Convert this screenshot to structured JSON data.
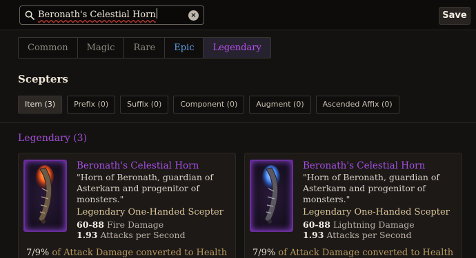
{
  "search": {
    "value": "Beronath's Celestial Horn",
    "clear_icon": "×"
  },
  "toolbar": {
    "save_label": "Save"
  },
  "rarity_tabs": [
    {
      "label": "Common",
      "color": "#8e8880"
    },
    {
      "label": "Magic",
      "color": "#8e8880"
    },
    {
      "label": "Rare",
      "color": "#8e8880"
    },
    {
      "label": "Epic",
      "color": "#5ea0e6"
    },
    {
      "label": "Legendary",
      "color": "#b453e8",
      "active": true
    }
  ],
  "section": {
    "title": "Scepters"
  },
  "subtabs": [
    {
      "label": "Item (3)",
      "active": true
    },
    {
      "label": "Prefix (0)"
    },
    {
      "label": "Suffix (0)"
    },
    {
      "label": "Component (0)"
    },
    {
      "label": "Augment (0)"
    },
    {
      "label": "Ascended Affix (0)"
    }
  ],
  "group": {
    "title": "Legendary (3)"
  },
  "items": [
    {
      "name": "Beronath's Celestial Horn",
      "description": "\"Horn of Beronath, guardian of Asterkarn and progenitor of monsters.\"",
      "type": "Legendary One-Handed Scepter",
      "damage_value": "60-88",
      "damage_label": "Fire Damage",
      "speed_value": "1.93",
      "speed_label": "Attacks per Second",
      "affix_value": "7/9%",
      "affix_text": "of Attack Damage converted to Health",
      "icon": "fire-horn-icon",
      "glow_color": "#ff5a1a"
    },
    {
      "name": "Beronath's Celestial Horn",
      "description": "\"Horn of Beronath, guardian of Asterkarn and progenitor of monsters.\"",
      "type": "Legendary One-Handed Scepter",
      "damage_value": "60-88",
      "damage_label": "Lightning Damage",
      "speed_value": "1.93",
      "speed_label": "Attacks per Second",
      "affix_value": "7/9%",
      "affix_text": "of Attack Damage converted to Health",
      "icon": "lightning-horn-icon",
      "glow_color": "#4a8dff"
    }
  ]
}
